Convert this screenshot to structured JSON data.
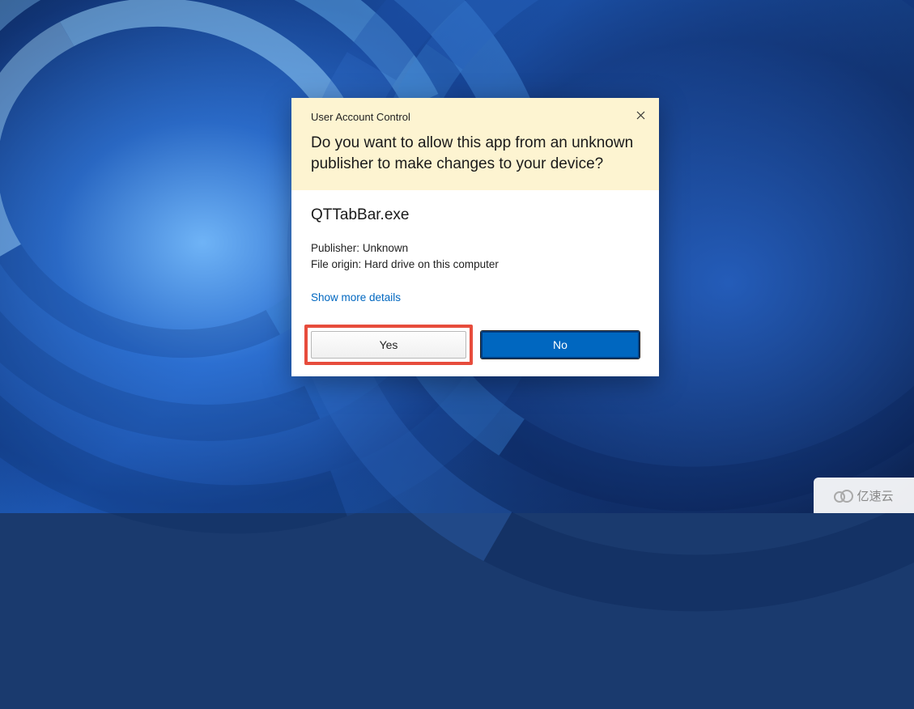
{
  "dialog": {
    "title": "User Account Control",
    "heading": "Do you want to allow this app from an unknown publisher to make changes to your device?",
    "app_name": "QTTabBar.exe",
    "publisher_label": "Publisher:",
    "publisher_value": "Unknown",
    "origin_label": "File origin:",
    "origin_value": "Hard drive on this computer",
    "details_link": "Show more details",
    "yes_label": "Yes",
    "no_label": "No"
  },
  "watermark": {
    "text": "亿速云"
  }
}
